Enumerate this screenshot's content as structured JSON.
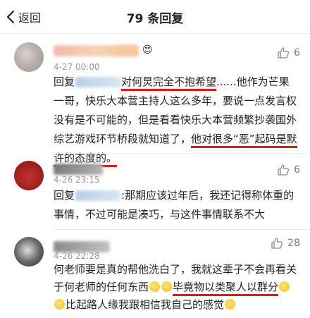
{
  "header": {
    "back_label": "返回",
    "title": "79 条回复"
  },
  "comments": [
    {
      "time": "4-27 00:00",
      "likes": "6",
      "reply_prefix": "回复",
      "text_a": "对何炅完全不抱希望",
      "text_b": "......他作为芒果一哥，快乐大本营主持人这么多年，要说一点发言权没有是不可能的，但是看看快乐大本营频繁抄袭国外综艺游戏环节桥段就知道了，",
      "text_c": "他对很多“恶”起码是默许的态度的。"
    },
    {
      "time": "4-26 23:15",
      "likes": "6",
      "reply_prefix": "回复",
      "text": ":那期应该过年后，我还记得称体重的事情，不过可能是凑巧，与这件事情联系不大"
    },
    {
      "time": "4-26 22:28",
      "likes": "28",
      "text_a": "何老师要是真的帮他洗白了，我就这辈子不会再看关于何老师的任何东西",
      "text_b": "毕竟物以类聚人以群分",
      "text_c": "比起路人缘我跟相信我自己的感觉"
    }
  ]
}
